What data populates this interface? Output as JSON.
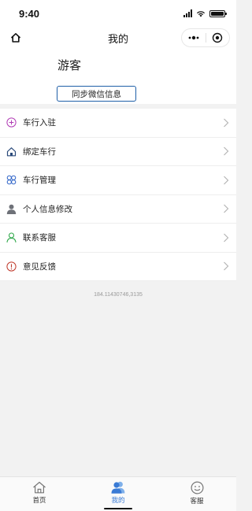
{
  "status_bar": {
    "time": "9:40"
  },
  "nav": {
    "title": "我的"
  },
  "profile": {
    "name": "游客",
    "sync_label": "同步微信信息"
  },
  "menu": {
    "items": [
      {
        "label": "车行入驻",
        "icon": "plus-circle-icon",
        "color": "#b13cb5"
      },
      {
        "label": "绑定车行",
        "icon": "house-icon",
        "color": "#2a4a7a"
      },
      {
        "label": "车行管理",
        "icon": "clover-icon",
        "color": "#2f64c8"
      },
      {
        "label": "个人信息修改",
        "icon": "person-icon",
        "color": "#6e7178"
      },
      {
        "label": "联系客服",
        "icon": "contact-person-icon",
        "color": "#2fa84a"
      },
      {
        "label": "意见反馈",
        "icon": "info-circle-icon",
        "color": "#c0392b"
      }
    ]
  },
  "coords_text": "184.11430746,3135",
  "tabbar": {
    "tabs": [
      {
        "label": "首页",
        "icon": "home-icon"
      },
      {
        "label": "我的",
        "icon": "users-icon",
        "active": true
      },
      {
        "label": "客服",
        "icon": "smiley-icon"
      }
    ]
  },
  "colors": {
    "accent": "#3a7bd5",
    "button_border": "#1f5fa8"
  }
}
